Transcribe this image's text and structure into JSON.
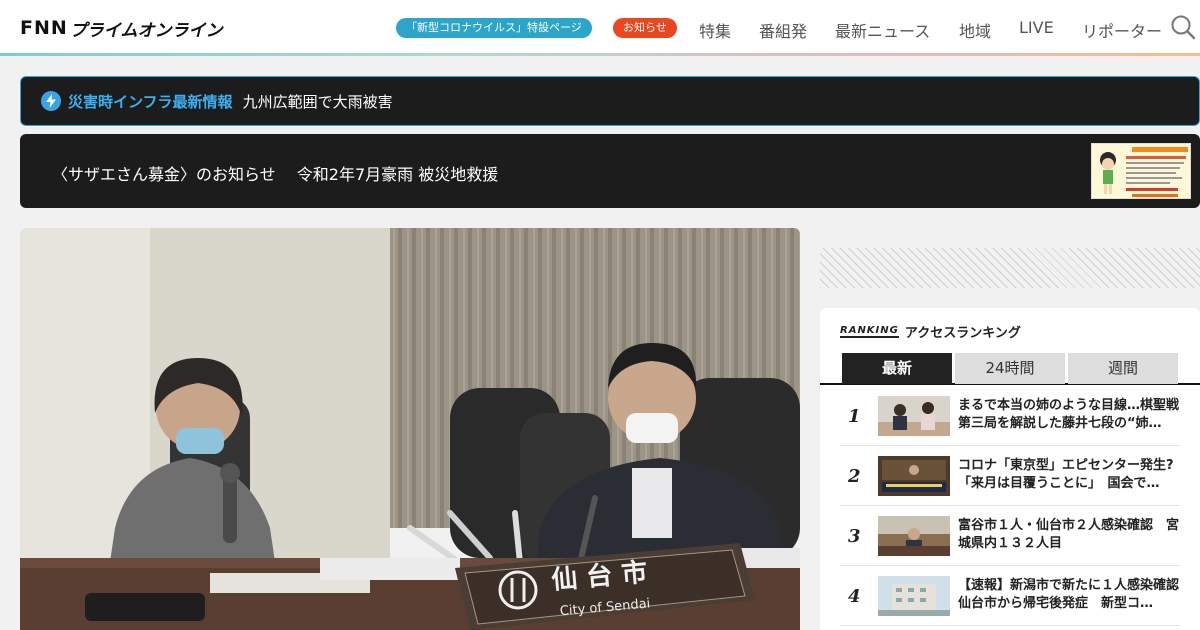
{
  "header": {
    "logo_fnn": "FNN",
    "logo_text": "プライムオンライン",
    "covid_pill": "「新型コロナウイルス」特設ページ",
    "notice_pill": "お知らせ",
    "nav": [
      "特集",
      "番組発",
      "最新ニュース",
      "地域",
      "LIVE",
      "リポーター"
    ],
    "search_icon": "search-icon"
  },
  "alert": {
    "label": "災害時インフラ最新情報",
    "text": "九州広範囲で大雨被害",
    "icon": "lightning-icon"
  },
  "banner": {
    "text": "〈サザエさん募金〉のお知らせ　 令和2年7月豪雨 被災地救援"
  },
  "hero": {
    "sign_kanji": "仙 台 市",
    "sign_roman": "City of Sendai"
  },
  "ranking": {
    "logo": "RANKING",
    "heading": "アクセスランキング",
    "tabs": [
      "最新",
      "24時間",
      "週間"
    ],
    "active_tab": "最新",
    "items": [
      {
        "rank": "1",
        "text": "まるで本当の姉のような目線…棋聖戦第三局を解説した藤井七段の“姉…"
      },
      {
        "rank": "2",
        "text": "コロナ「東京型」エピセンター発生?「来月は目覆うことに」　国会で…"
      },
      {
        "rank": "3",
        "text": "富谷市１人・仙台市２人感染確認　宮城県内１３２人目"
      },
      {
        "rank": "4",
        "text": "【速報】新潟市で新たに１人感染確認　仙台市から帰宅後発症　新型コ…"
      }
    ]
  },
  "colors": {
    "accent_blue": "#2ba6c8",
    "notice_red": "#e8471f",
    "alert_blue": "#3ab0f0",
    "dark_bg": "#1c1c1c"
  }
}
